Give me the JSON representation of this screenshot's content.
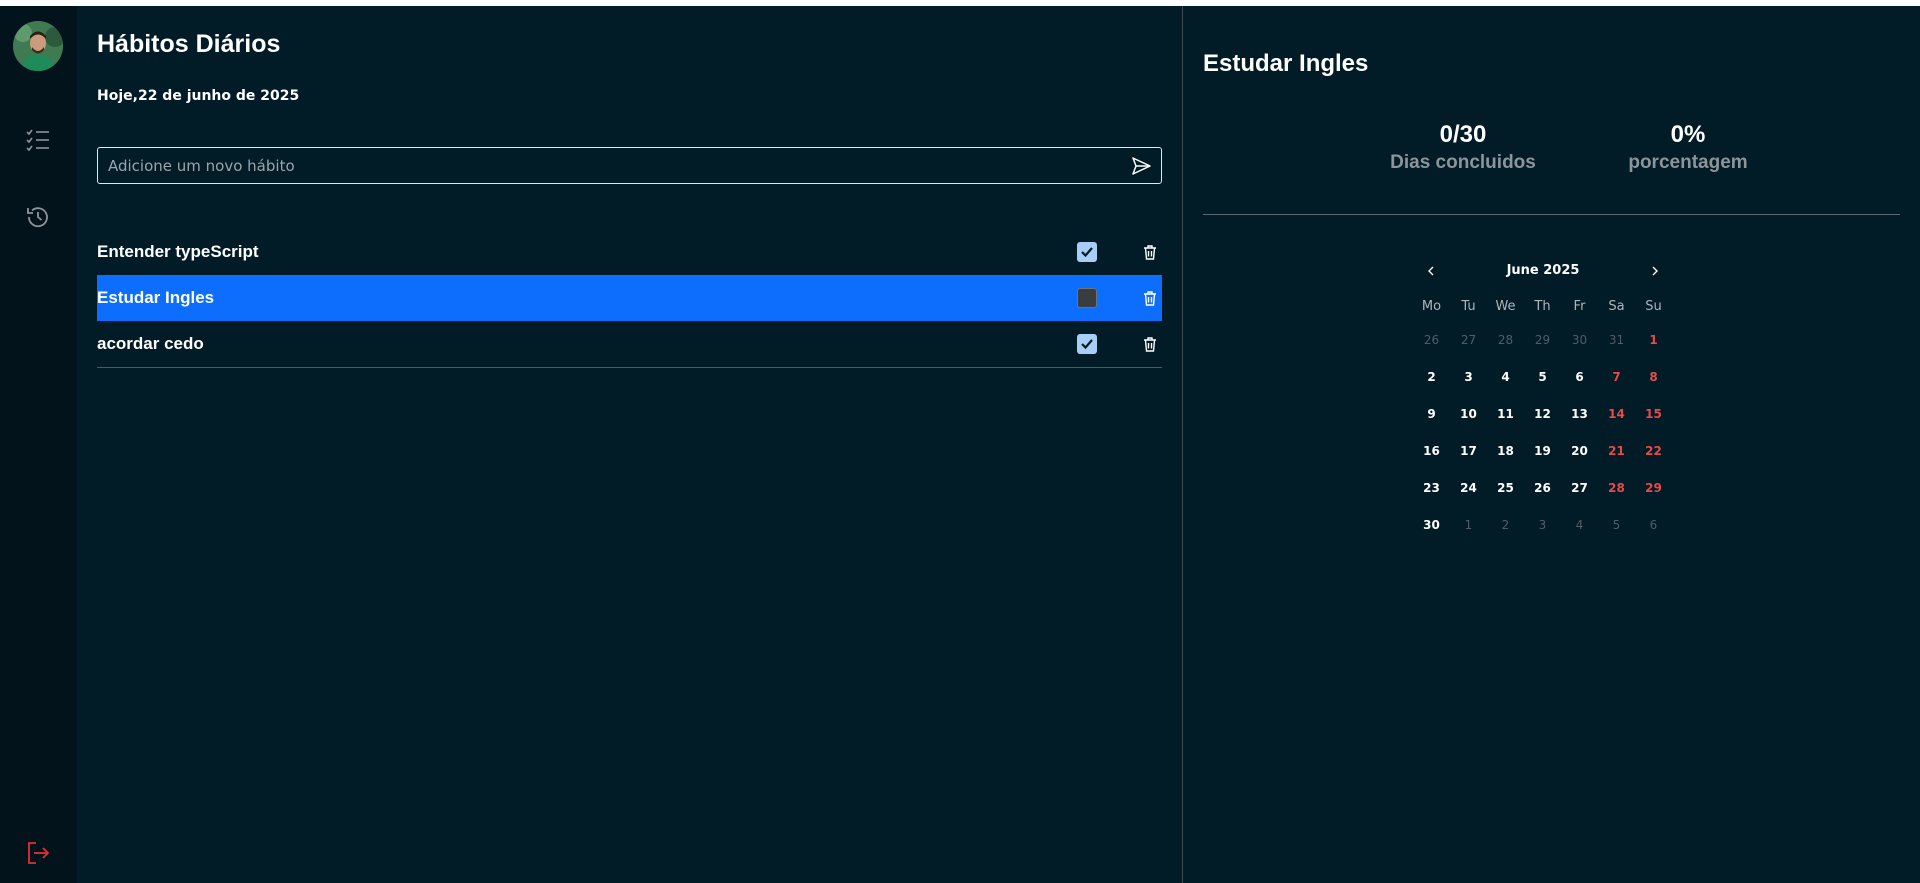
{
  "app": {
    "title": "Hábitos Diários",
    "date_label": "Hoje,22 de junho de 2025"
  },
  "sidebar": {
    "icons": [
      "avatar",
      "checklist-icon",
      "history-icon",
      "logout-icon"
    ]
  },
  "add_habit": {
    "placeholder": "Adicione um novo hábito",
    "value": ""
  },
  "habits": [
    {
      "name": "Entender typeScript",
      "checked": true,
      "selected": false
    },
    {
      "name": "Estudar Ingles",
      "checked": false,
      "selected": true
    },
    {
      "name": "acordar cedo",
      "checked": true,
      "selected": false
    }
  ],
  "detail": {
    "title": "Estudar Ingles",
    "stats": {
      "days_value": "0/30",
      "days_label": "Dias concluidos",
      "percent_value": "0%",
      "percent_label": "porcentagem"
    }
  },
  "calendar": {
    "month_label": "June 2025",
    "weekdays": [
      "Mo",
      "Tu",
      "We",
      "Th",
      "Fr",
      "Sa",
      "Su"
    ],
    "weeks": [
      [
        "26",
        "27",
        "28",
        "29",
        "30",
        "31",
        "1"
      ],
      [
        "2",
        "3",
        "4",
        "5",
        "6",
        "7",
        "8"
      ],
      [
        "9",
        "10",
        "11",
        "12",
        "13",
        "14",
        "15"
      ],
      [
        "16",
        "17",
        "18",
        "19",
        "20",
        "21",
        "22"
      ],
      [
        "23",
        "24",
        "25",
        "26",
        "27",
        "28",
        "29"
      ],
      [
        "30",
        "1",
        "2",
        "3",
        "4",
        "5",
        "6"
      ]
    ],
    "other_month_cells": [
      [
        0,
        0
      ],
      [
        0,
        1
      ],
      [
        0,
        2
      ],
      [
        0,
        3
      ],
      [
        0,
        4
      ],
      [
        0,
        5
      ],
      [
        5,
        1
      ],
      [
        5,
        2
      ],
      [
        5,
        3
      ],
      [
        5,
        4
      ],
      [
        5,
        5
      ],
      [
        5,
        6
      ]
    ],
    "weekend_color": "#e84a4a"
  },
  "colors": {
    "background": "#011b27",
    "sidebar": "#02131b",
    "selected_row": "#0d6efd",
    "checkbox_checked": "#a8cdf6",
    "logout": "#e03131"
  }
}
